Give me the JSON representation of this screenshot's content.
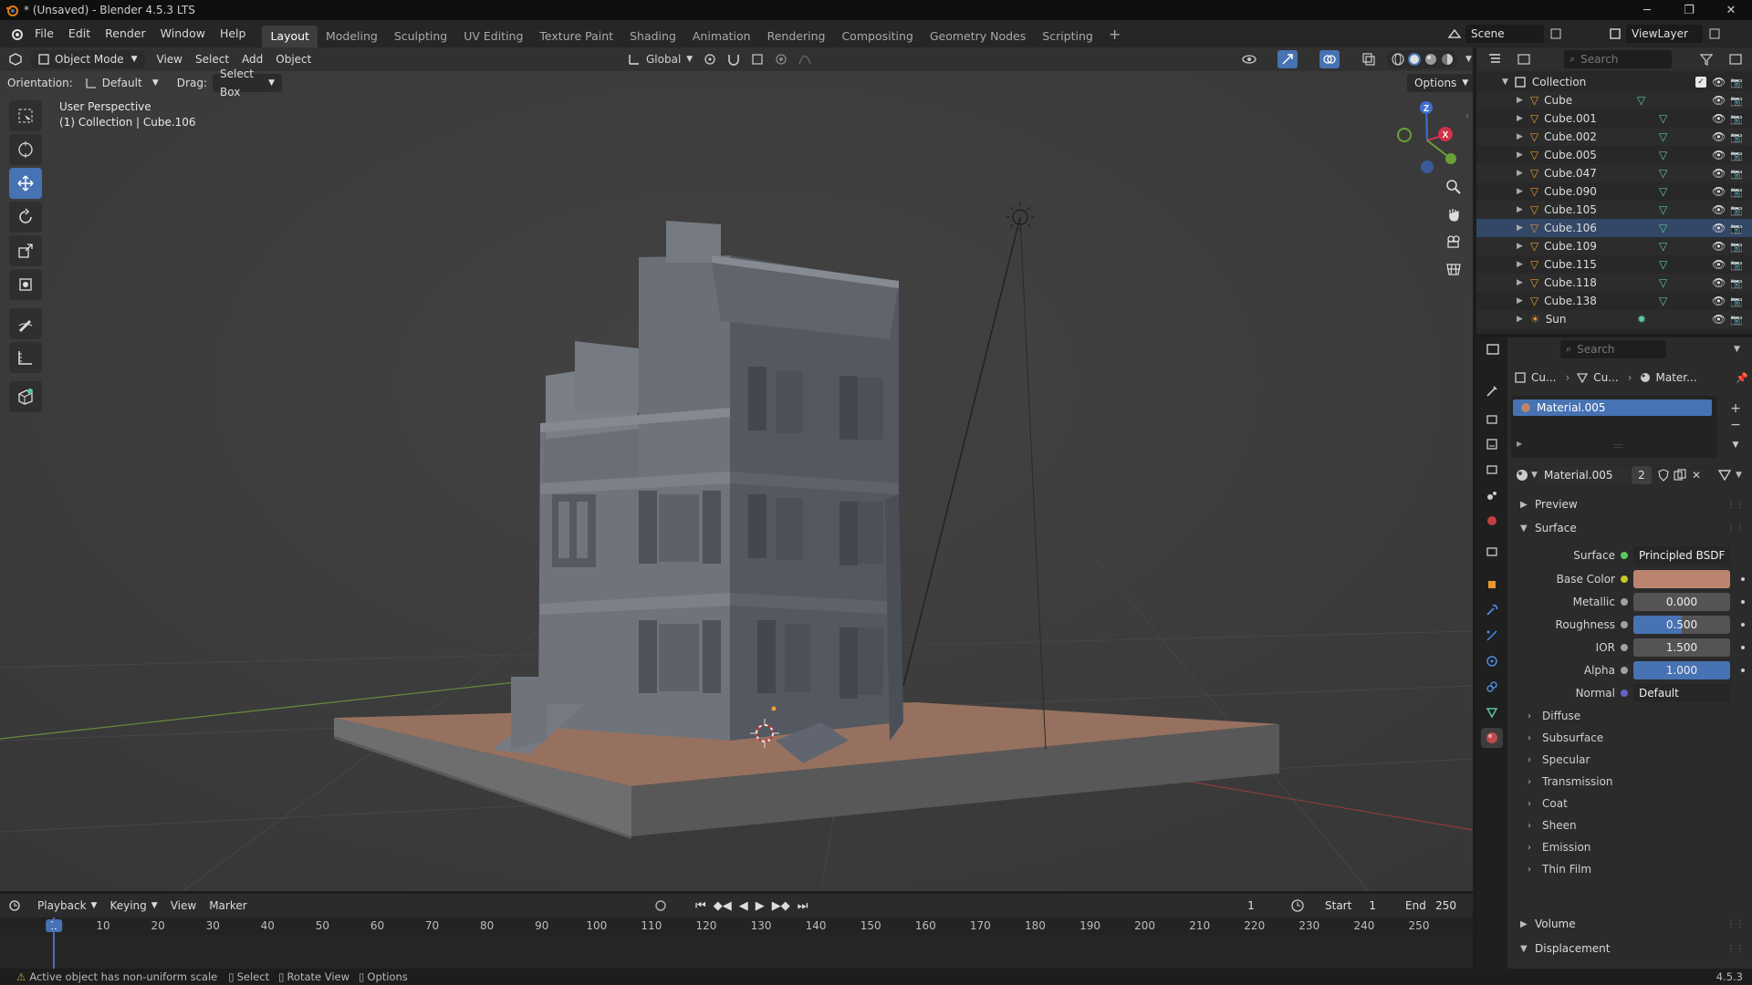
{
  "window": {
    "title": "* (Unsaved) - Blender 4.5.3 LTS",
    "minimize": "─",
    "maximize": "❐",
    "close": "✕"
  },
  "menu": [
    "File",
    "Edit",
    "Render",
    "Window",
    "Help"
  ],
  "workspaces": [
    "Layout",
    "Modeling",
    "Sculpting",
    "UV Editing",
    "Texture Paint",
    "Shading",
    "Animation",
    "Rendering",
    "Compositing",
    "Geometry Nodes",
    "Scripting"
  ],
  "active_workspace": "Layout",
  "scene": {
    "name": "Scene",
    "view_layer": "ViewLayer"
  },
  "viewport": {
    "mode": "Object Mode",
    "menus": [
      "View",
      "Select",
      "Add",
      "Object"
    ],
    "transform_orientation": "Global",
    "orientation_label": "Orientation:",
    "orientation_value": "Default",
    "drag_label": "Drag:",
    "drag_value": "Select Box",
    "options_label": "Options",
    "overlay_line1": "User Perspective",
    "overlay_line2": "(1) Collection | Cube.106",
    "gizmo_axes": {
      "x": "X",
      "z": "Z"
    }
  },
  "outliner": {
    "search_placeholder": "Search",
    "collection": "Collection",
    "items": [
      {
        "name": "Cube",
        "type": "mesh"
      },
      {
        "name": "Cube.001",
        "type": "mesh"
      },
      {
        "name": "Cube.002",
        "type": "mesh"
      },
      {
        "name": "Cube.005",
        "type": "mesh"
      },
      {
        "name": "Cube.047",
        "type": "mesh"
      },
      {
        "name": "Cube.090",
        "type": "mesh"
      },
      {
        "name": "Cube.105",
        "type": "mesh"
      },
      {
        "name": "Cube.106",
        "type": "mesh"
      },
      {
        "name": "Cube.109",
        "type": "mesh"
      },
      {
        "name": "Cube.115",
        "type": "mesh"
      },
      {
        "name": "Cube.118",
        "type": "mesh"
      },
      {
        "name": "Cube.138",
        "type": "mesh"
      },
      {
        "name": "Sun",
        "type": "light"
      }
    ]
  },
  "properties": {
    "search_placeholder": "Search",
    "breadcrumb": [
      "Cu...",
      "Cu...",
      "Mater..."
    ],
    "slot_material": "Material.005",
    "material_name": "Material.005",
    "material_users": "2",
    "sections": {
      "preview": "Preview",
      "surface": "Surface",
      "volume": "Volume",
      "displacement": "Displacement"
    },
    "surface_label": "Surface",
    "surface_shader": "Principled BSDF",
    "fields": [
      {
        "label": "Base Color",
        "value": "",
        "color": "#b9836e",
        "dot": "#c7c729"
      },
      {
        "label": "Metallic",
        "value": "0.000",
        "fill": 0.0,
        "dot": "#a1a1a1"
      },
      {
        "label": "Roughness",
        "value": "0.500",
        "fill": 0.5,
        "dot": "#a1a1a1"
      },
      {
        "label": "IOR",
        "value": "1.500",
        "fill": 0.0,
        "dot": "#a1a1a1"
      },
      {
        "label": "Alpha",
        "value": "1.000",
        "fill": 1.0,
        "dot": "#a1a1a1"
      },
      {
        "label": "Normal",
        "value": "Default",
        "dot": "#6363c7"
      }
    ],
    "subsections": [
      "Diffuse",
      "Subsurface",
      "Specular",
      "Transmission",
      "Coat",
      "Sheen",
      "Emission",
      "Thin Film"
    ]
  },
  "timeline": {
    "menus": [
      "Playback",
      "Keying",
      "View",
      "Marker"
    ],
    "current_frame": "1",
    "start_label": "Start",
    "start": "1",
    "end_label": "End",
    "end": "250",
    "ticks": [
      "1",
      "10",
      "20",
      "30",
      "40",
      "50",
      "60",
      "70",
      "80",
      "90",
      "100",
      "110",
      "120",
      "130",
      "140",
      "150",
      "160",
      "170",
      "180",
      "190",
      "200",
      "210",
      "220",
      "230",
      "240",
      "250"
    ]
  },
  "statusbar": {
    "warning": "Active object has non-uniform scale",
    "select": "Select",
    "rotate": "Rotate View",
    "options": "Options",
    "version": "4.5.3"
  },
  "colors": {
    "accent": "#4772b3",
    "mesh_icon": "#e8962e",
    "data_icon": "#5dc79c",
    "viewport_bg": "#3b3b3b",
    "base_color": "#b9836e"
  }
}
